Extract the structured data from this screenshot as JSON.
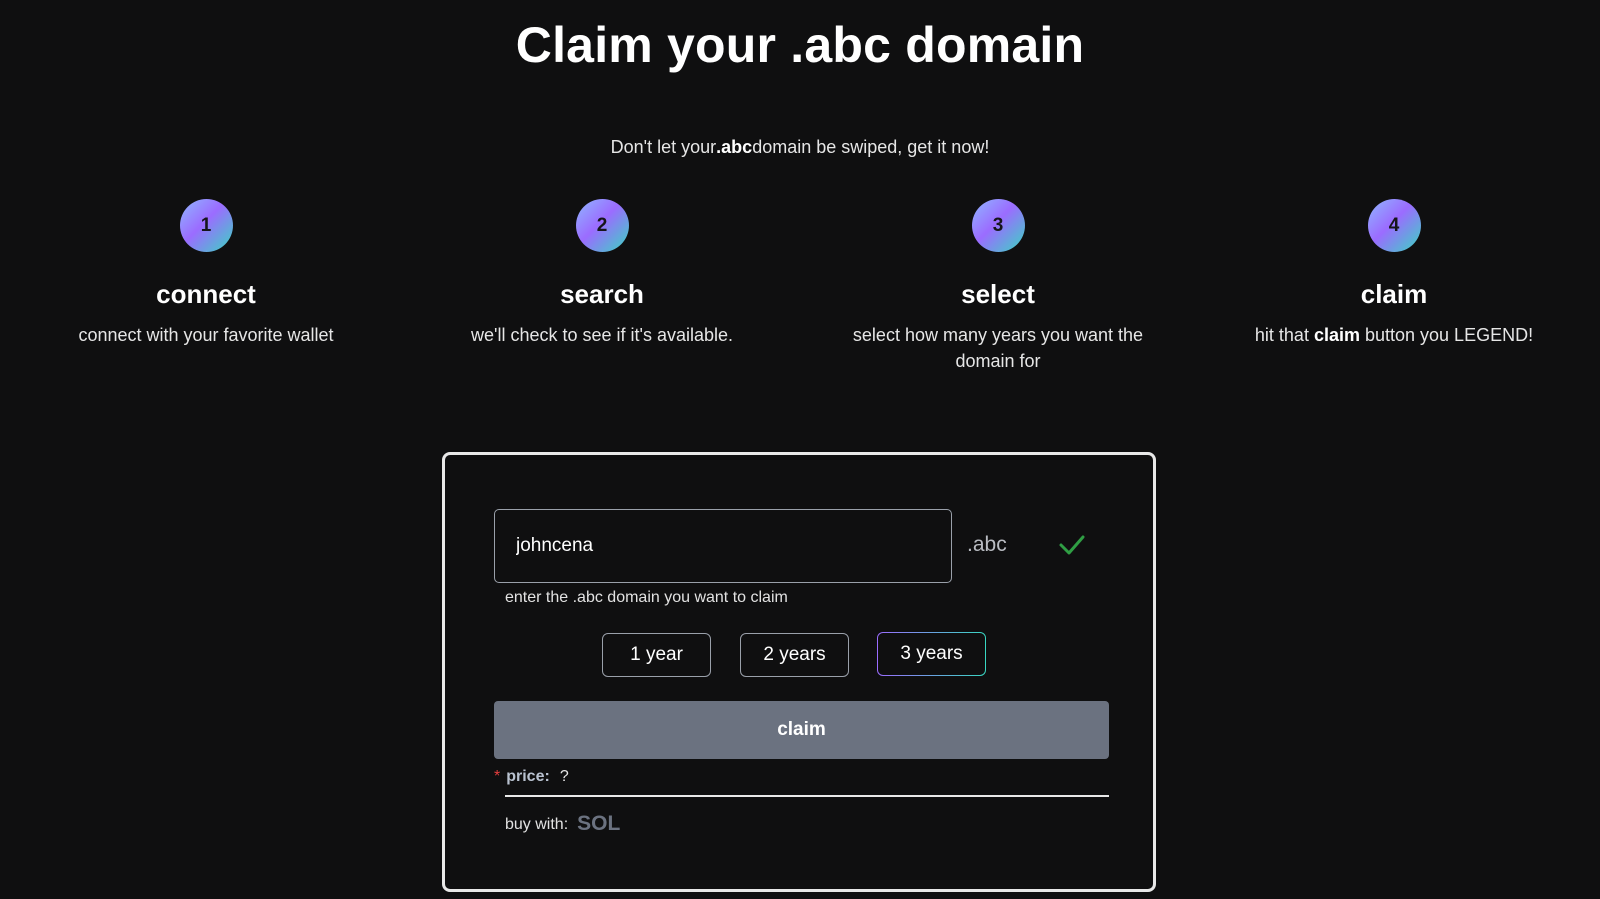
{
  "header": {
    "title": "Claim your .abc domain",
    "tagline_before": "Don't let your",
    "tagline_bold": ".abc",
    "tagline_after": "domain be swiped, get it now!"
  },
  "steps": [
    {
      "number": "1",
      "title": "connect",
      "desc": "connect with your favorite wallet"
    },
    {
      "number": "2",
      "title": "search",
      "desc": "we'll check to see if it's available."
    },
    {
      "number": "3",
      "title": "select",
      "desc": "select how many years you want the domain for"
    },
    {
      "number": "4",
      "title": "claim",
      "desc_before": "hit that ",
      "desc_bold": "claim",
      "desc_after": " button you LEGEND!"
    }
  ],
  "form": {
    "domain_value": "johncena",
    "suffix": ".abc",
    "availability_icon": "check-icon",
    "availability_color": "#2f9e44",
    "helper": "enter the .abc domain you want to claim",
    "year_options": [
      "1 year",
      "2 years",
      "3 years"
    ],
    "selected_year": "3 years",
    "claim_label": "claim",
    "price_required_mark": "*",
    "price_label": "price:",
    "price_value": "?",
    "buy_with_label": "buy with:",
    "currency": "SOL"
  },
  "colors": {
    "background": "#0f0f10",
    "claim_button": "#6b7280",
    "accent_gradient_start": "#9b6cff",
    "accent_gradient_end": "#38d7c1"
  }
}
